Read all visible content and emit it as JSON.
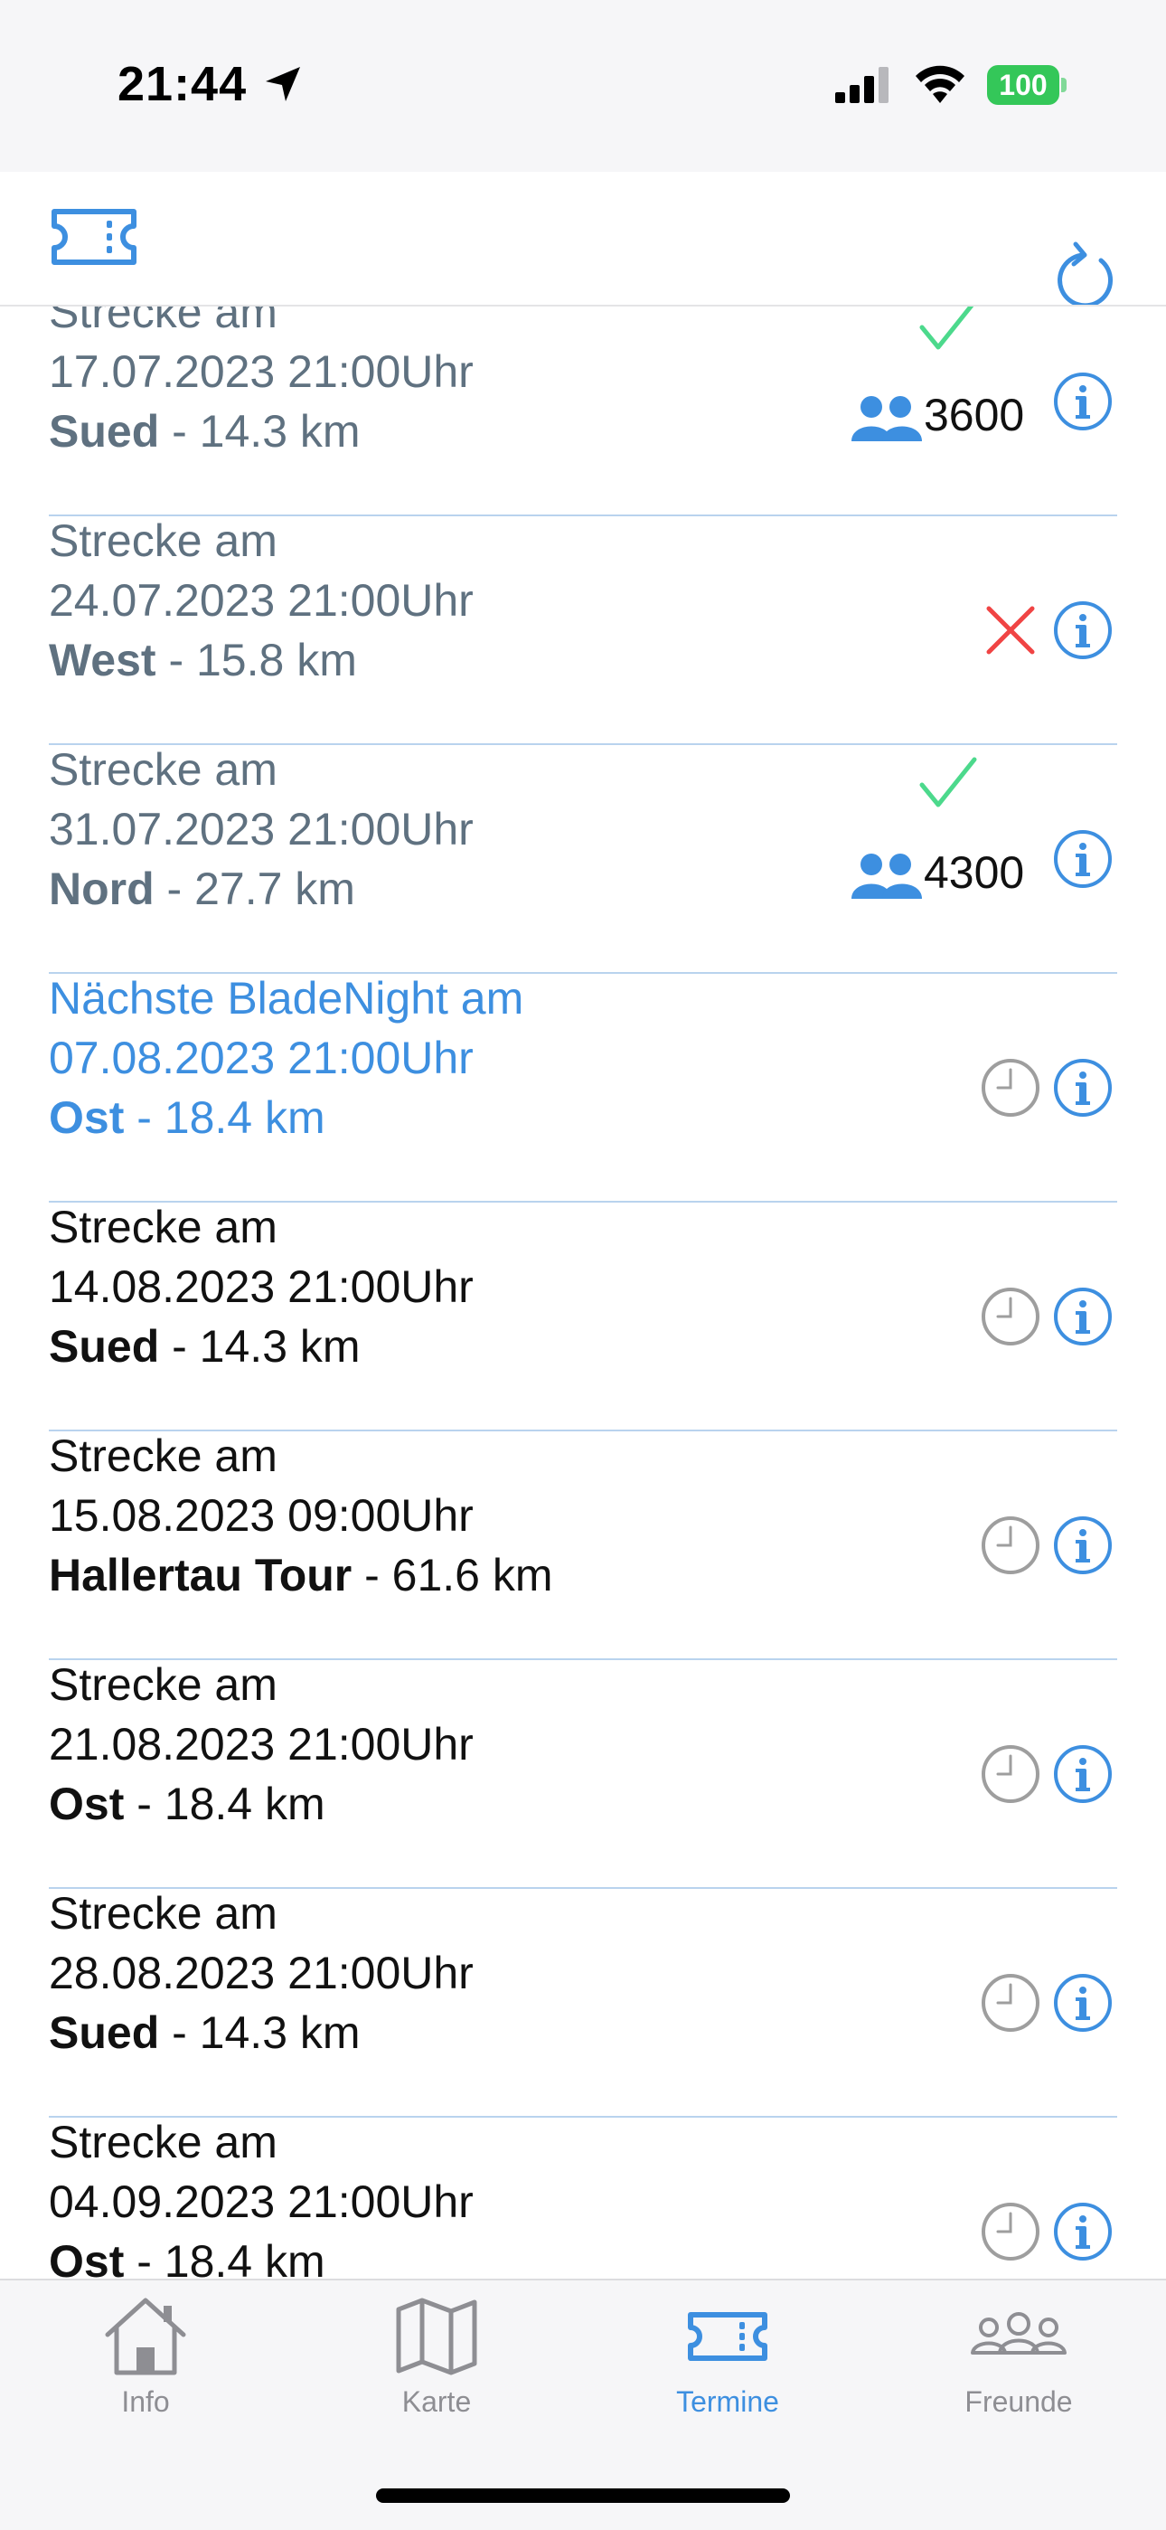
{
  "status_bar": {
    "time": "21:44",
    "battery": "100"
  },
  "events": [
    {
      "label": "Strecke am",
      "datetime": "17.07.2023 21:00Uhr",
      "route": "Sued",
      "distance": " - 14.3 km",
      "state": "past",
      "status": "confirmed",
      "participants": "3600"
    },
    {
      "label": "Strecke am",
      "datetime": "24.07.2023 21:00Uhr",
      "route": "West",
      "distance": " - 15.8 km",
      "state": "past",
      "status": "cancelled"
    },
    {
      "label": "Strecke am",
      "datetime": "31.07.2023 21:00Uhr",
      "route": "Nord",
      "distance": " - 27.7 km",
      "state": "past",
      "status": "confirmed",
      "participants": "4300"
    },
    {
      "label": "Nächste BladeNight am",
      "datetime": "07.08.2023 21:00Uhr",
      "route": "Ost",
      "distance": " - 18.4 km",
      "state": "next",
      "status": "pending"
    },
    {
      "label": "Strecke am",
      "datetime": "14.08.2023 21:00Uhr",
      "route": "Sued",
      "distance": " - 14.3 km",
      "state": "future",
      "status": "pending"
    },
    {
      "label": "Strecke am",
      "datetime": "15.08.2023 09:00Uhr",
      "route": "Hallertau Tour",
      "distance": " - 61.6 km",
      "state": "future",
      "status": "pending"
    },
    {
      "label": "Strecke am",
      "datetime": "21.08.2023 21:00Uhr",
      "route": "Ost",
      "distance": " - 18.4 km",
      "state": "future",
      "status": "pending"
    },
    {
      "label": "Strecke am",
      "datetime": "28.08.2023 21:00Uhr",
      "route": "Sued",
      "distance": " - 14.3 km",
      "state": "future",
      "status": "pending"
    },
    {
      "label": "Strecke am",
      "datetime": "04.09.2023 21:00Uhr",
      "route": "Ost",
      "distance": " - 18.4 km",
      "state": "future",
      "status": "pending"
    }
  ],
  "tabs": [
    {
      "label": "Info",
      "icon": "house-icon",
      "active": false
    },
    {
      "label": "Karte",
      "icon": "map-icon",
      "active": false
    },
    {
      "label": "Termine",
      "icon": "ticket-icon",
      "active": true
    },
    {
      "label": "Freunde",
      "icon": "people-icon",
      "active": false
    }
  ],
  "colors": {
    "accent": "#3d8fe0",
    "past_text": "#5f7180",
    "confirmed": "#4cd98c",
    "cancelled": "#f04444",
    "pending_icon": "#9e9e9e",
    "battery": "#34c759"
  }
}
